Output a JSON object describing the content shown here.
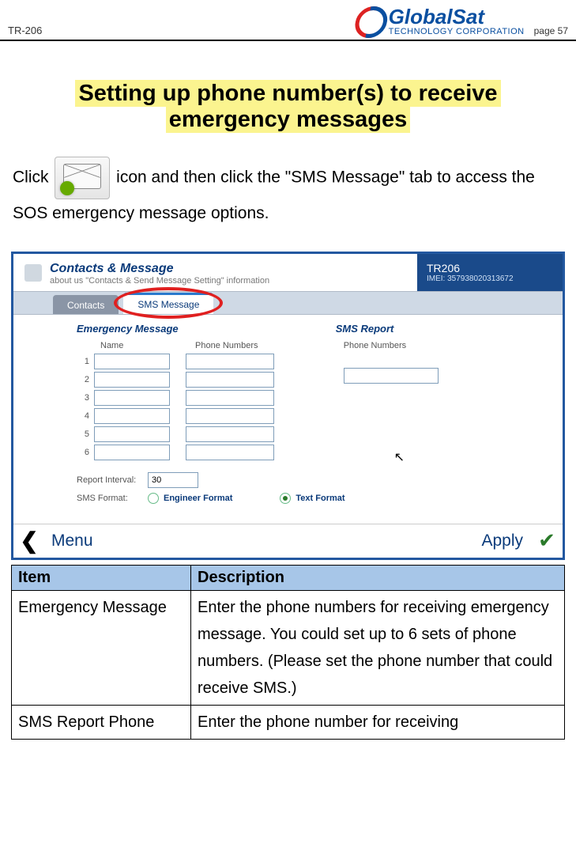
{
  "header": {
    "doc_id": "TR-206",
    "logo_main": "GlobalSat",
    "logo_sub": "TECHNOLOGY CORPORATION",
    "page_label": "page 57"
  },
  "title_line1": "Setting up phone number(s) to receive",
  "title_line2": "emergency messages",
  "intro_before": "Click ",
  "intro_after": " icon and then click the \"SMS Message\" tab to access the SOS emergency message options.",
  "screenshot": {
    "header_title": "Contacts & Message",
    "header_sub": "about us \"Contacts & Send Message Setting\" information",
    "device_name": "TR206",
    "device_imei": "IMEI: 357938020313672",
    "tab_contacts": "Contacts",
    "tab_sms": "SMS Message",
    "sec_emergency": "Emergency Message",
    "sec_sms_report": "SMS Report",
    "col_name": "Name",
    "col_phone": "Phone Numbers",
    "col_phone2": "Phone Numbers",
    "rows": [
      "1",
      "2",
      "3",
      "4",
      "5",
      "6"
    ],
    "report_interval_label": "Report Interval:",
    "report_interval_value": "30",
    "sms_format_label": "SMS Format:",
    "fmt_engineer": "Engineer Format",
    "fmt_text": "Text Format",
    "footer_menu": "Menu",
    "footer_apply": "Apply"
  },
  "table": {
    "h1": "Item",
    "h2": "Description",
    "r1c1": "Emergency Message",
    "r1c2": "Enter the phone numbers for receiving emergency message. You could set up to 6 sets of phone numbers. (Please set the phone number that could receive SMS.)",
    "r2c1": "SMS Report Phone",
    "r2c2": "Enter the phone number for receiving"
  }
}
